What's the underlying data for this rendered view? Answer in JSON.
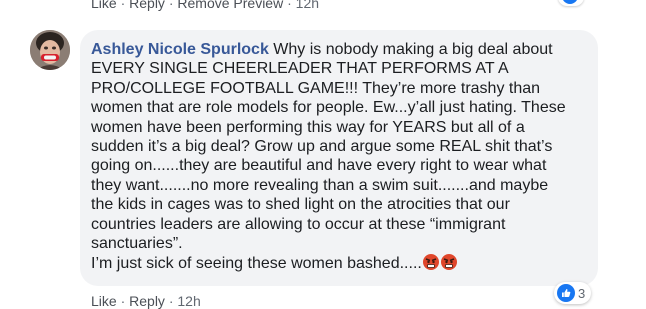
{
  "top_actions": {
    "like": "Like",
    "sep1": " · ",
    "reply": "Reply",
    "sep2": " · ",
    "remove_preview": "Remove Preview",
    "sep3": " · ",
    "time": "12h"
  },
  "comment": {
    "author": "Ashley Nicole Spurlock",
    "lines": [
      "Why is nobody making a big deal about",
      "EVERY SINGLE CHEERLEADER THAT PERFORMS AT A",
      "PRO/COLLEGE FOOTBALL GAME!!! They’re more trashy than",
      "women that are role models for people. Ew...y’all just hating. These",
      "women have been performing this way for YEARS but all of a",
      "sudden it’s a big deal? Grow up and argue some REAL shit that’s",
      "going on......they are beautiful and have every right to wear what",
      "they want.......no more revealing than a swim suit.......and maybe",
      "the kids in cages was to shed light on the atrocities that our",
      "countries leaders are allowing to occur at these “immigrant",
      "sanctuaries”.",
      "I’m just sick of seeing these women bashed....."
    ],
    "emoji": [
      "angry-face-emoji",
      "angry-face-emoji"
    ]
  },
  "reactions": {
    "count": "3",
    "icon": "like-icon",
    "color": "#1877f2"
  },
  "bottom_actions": {
    "like": "Like",
    "sep1": " · ",
    "reply": "Reply",
    "sep2": " · ",
    "time": "12h"
  }
}
